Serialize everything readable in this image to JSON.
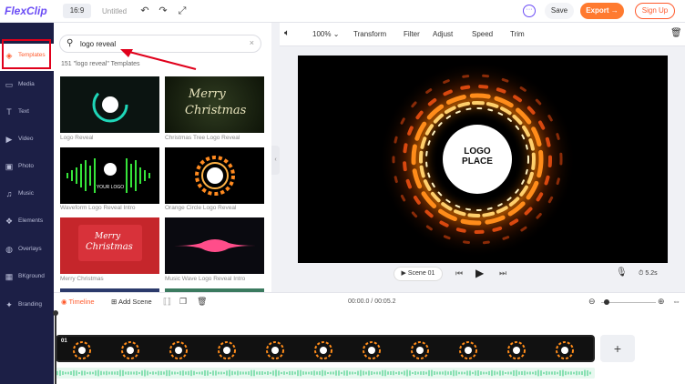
{
  "app": {
    "logo_text": "FlexClip",
    "ratio": "16:9",
    "project_title": "Untitled",
    "save_label": "Save",
    "export_label": "Export",
    "signup_label": "Sign Up"
  },
  "sidebar": {
    "items": [
      {
        "label": "Templates",
        "icon": "layers-icon",
        "active": true
      },
      {
        "label": "Media",
        "icon": "media-icon"
      },
      {
        "label": "Text",
        "icon": "text-icon"
      },
      {
        "label": "Video",
        "icon": "video-icon"
      },
      {
        "label": "Photo",
        "icon": "photo-icon"
      },
      {
        "label": "Music",
        "icon": "music-icon"
      },
      {
        "label": "Elements",
        "icon": "elements-icon"
      },
      {
        "label": "Overlays",
        "icon": "overlays-icon"
      },
      {
        "label": "BKground",
        "icon": "background-icon"
      },
      {
        "label": "Branding",
        "icon": "branding-icon"
      }
    ]
  },
  "templates": {
    "search_value": "logo reveal",
    "count_text": "151 \"logo reveal\" Templates",
    "items": [
      {
        "label": "Logo Reveal"
      },
      {
        "label": "Christmas Tree Logo Reveal",
        "text": "Merry Christmas"
      },
      {
        "label": "Waveform Logo Reveal Intro"
      },
      {
        "label": "Orange Circle Logo Reveal"
      },
      {
        "label": "Merry Christmas"
      },
      {
        "label": "Music Wave Logo Reveal Intro"
      }
    ],
    "thumb_texts": {
      "your_logo": "YOUR LOGO",
      "merry": "Merry",
      "christmas": "Christmas"
    }
  },
  "toolbar": {
    "zoom": "100%",
    "transform": "Transform",
    "filter": "Filter",
    "adjust": "Adjust",
    "speed": "Speed",
    "trim": "Trim"
  },
  "preview": {
    "logo_line1": "LOGO",
    "logo_line2": "PLACE",
    "scene_label": "Scene 01",
    "duration": "5.2s"
  },
  "timeline": {
    "tab_label": "Timeline",
    "add_scene_label": "Add Scene",
    "time": "00:00.0 / 00:05.2",
    "track_number": "01",
    "plus": "+"
  },
  "colors": {
    "brand_orange": "#ff7a2f",
    "sidebar_bg": "#1c1f46",
    "annotation_red": "#e0001b"
  }
}
